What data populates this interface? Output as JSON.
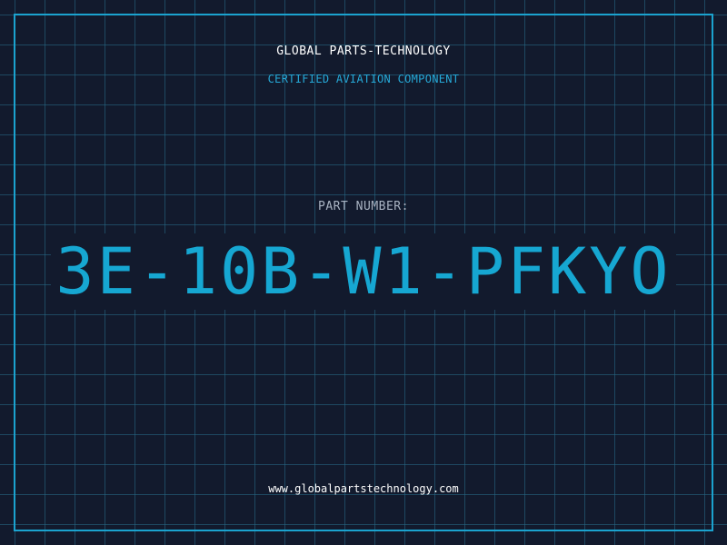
{
  "header": {
    "company_name": "GLOBAL PARTS-TECHNOLOGY",
    "subtitle": "CERTIFIED AVIATION COMPONENT"
  },
  "part": {
    "label": "PART NUMBER:",
    "number": "3E-10B-W1-PFKYO"
  },
  "footer": {
    "website": "www.globalpartstechnology.com"
  },
  "colors": {
    "background": "#121a2d",
    "grid": "#286e8c",
    "accent": "#1ba3cf",
    "text": "#ffffff",
    "muted_text": "#a9b3c2"
  }
}
